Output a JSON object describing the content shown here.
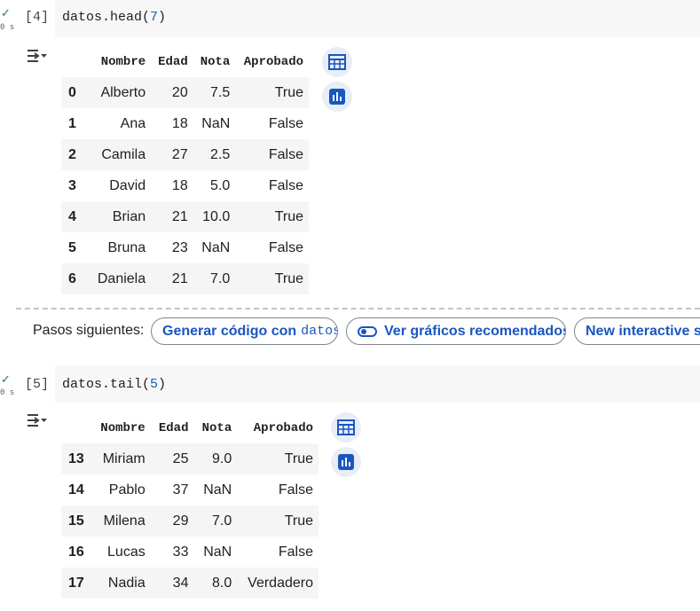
{
  "cells": [
    {
      "exec_count": "[4]",
      "status": "✓",
      "duration": "0 s",
      "code_prefix": "datos.head(",
      "code_arg": "7",
      "code_suffix": ")",
      "table": {
        "columns": [
          "Nombre",
          "Edad",
          "Nota",
          "Aprobado"
        ],
        "rows": [
          {
            "index": "0",
            "cells": [
              "Alberto",
              "20",
              "7.5",
              "True"
            ]
          },
          {
            "index": "1",
            "cells": [
              "Ana",
              "18",
              "NaN",
              "False"
            ]
          },
          {
            "index": "2",
            "cells": [
              "Camila",
              "27",
              "2.5",
              "False"
            ]
          },
          {
            "index": "3",
            "cells": [
              "David",
              "18",
              "5.0",
              "False"
            ]
          },
          {
            "index": "4",
            "cells": [
              "Brian",
              "21",
              "10.0",
              "True"
            ]
          },
          {
            "index": "5",
            "cells": [
              "Bruna",
              "23",
              "NaN",
              "False"
            ]
          },
          {
            "index": "6",
            "cells": [
              "Daniela",
              "21",
              "7.0",
              "True"
            ]
          }
        ]
      }
    },
    {
      "exec_count": "[5]",
      "status": "✓",
      "duration": "0 s",
      "code_prefix": "datos.tail(",
      "code_arg": "5",
      "code_suffix": ")",
      "table": {
        "columns": [
          "Nombre",
          "Edad",
          "Nota",
          "Aprobado"
        ],
        "rows": [
          {
            "index": "13",
            "cells": [
              "Miriam",
              "25",
              "9.0",
              "True"
            ]
          },
          {
            "index": "14",
            "cells": [
              "Pablo",
              "37",
              "NaN",
              "False"
            ]
          },
          {
            "index": "15",
            "cells": [
              "Milena",
              "29",
              "7.0",
              "True"
            ]
          },
          {
            "index": "16",
            "cells": [
              "Lucas",
              "33",
              "NaN",
              "False"
            ]
          },
          {
            "index": "17",
            "cells": [
              "Nadia",
              "34",
              "8.0",
              "Verdadero"
            ]
          }
        ]
      }
    }
  ],
  "next_steps": {
    "label": "Pasos siguientes:",
    "chips": [
      {
        "label": "Generar código con",
        "mono": "datos"
      },
      {
        "label": "Ver gráficos recomendados"
      },
      {
        "label": "New interactive sheet"
      }
    ]
  },
  "colors": {
    "accent": "#1a56c0",
    "success": "#188038",
    "code_number": "#1a5fb4"
  }
}
